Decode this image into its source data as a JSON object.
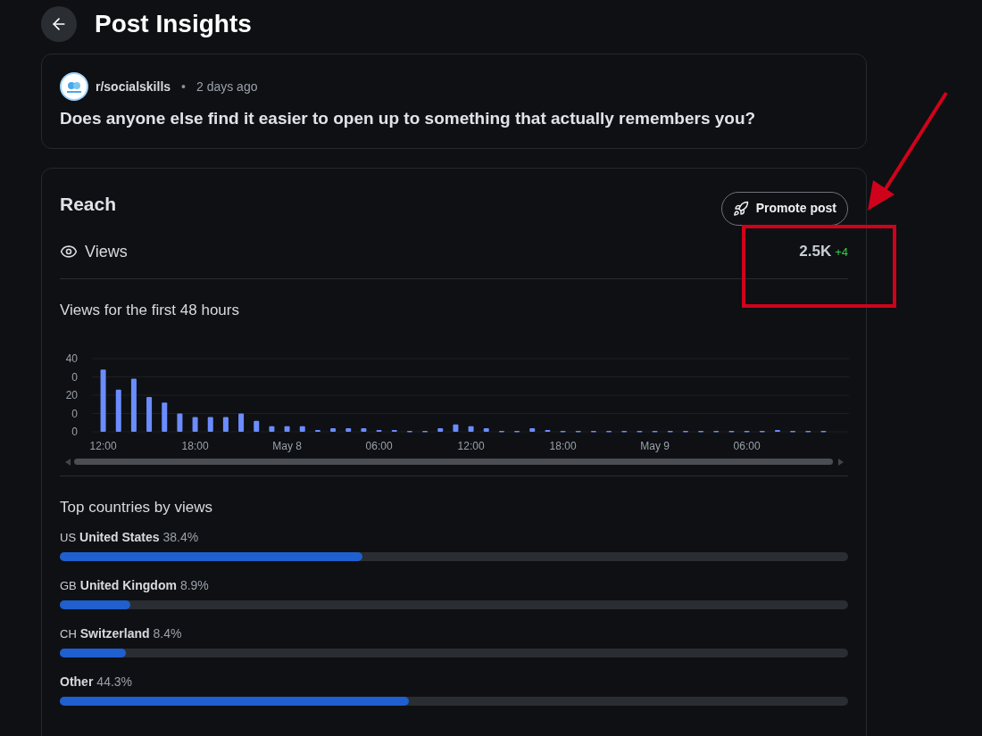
{
  "header": {
    "title": "Post Insights"
  },
  "post": {
    "community": "r/socialskills",
    "separator": "•",
    "time": "2 days ago",
    "title": "Does anyone else find it easier to open up to something that actually remembers you?"
  },
  "reach": {
    "title": "Reach",
    "promote_button": "Promote post",
    "metric": {
      "label": "Views",
      "value": "2.5K",
      "change": "+4"
    },
    "chart_title": "Views for the first 48 hours",
    "chart_data": {
      "type": "bar",
      "categories": [
        "12:00",
        null,
        null,
        null,
        null,
        null,
        "18:00",
        null,
        null,
        null,
        null,
        null,
        "May 8",
        null,
        null,
        null,
        null,
        null,
        "06:00",
        null,
        null,
        null,
        null,
        null,
        "12:00",
        null,
        null,
        null,
        null,
        null,
        "18:00",
        null,
        null,
        null,
        null,
        null,
        "May 9",
        null,
        null,
        null,
        null,
        null,
        "06:00",
        null,
        null,
        null,
        null,
        null
      ],
      "series": [
        {
          "color": "#6b8cff",
          "values": [
            34,
            23,
            29,
            19,
            16,
            10,
            8,
            8,
            8,
            10,
            6,
            3,
            3,
            3,
            1,
            2,
            2,
            2,
            1,
            1,
            0.5,
            0.5,
            2,
            4,
            3,
            2,
            0.5,
            0.5,
            2,
            1,
            0.5,
            0.5,
            0.5,
            0.5,
            0.5,
            0.5,
            0.5,
            0.5,
            0.5,
            0.5,
            0.5,
            0.5,
            0.5,
            0.5,
            1,
            0.5,
            0.5,
            0.5
          ]
        }
      ],
      "ylim": [
        0,
        40
      ],
      "yticks": [
        0,
        20,
        40
      ]
    },
    "chart_clipped_y_labels": [
      "0",
      "0"
    ],
    "countries_title": "Top countries by views",
    "countries": [
      {
        "code": "US",
        "name": "United States",
        "share": "38.4%",
        "level": 0.384
      },
      {
        "code": "GB",
        "name": "United Kingdom",
        "share": "8.9%",
        "level": 0.089
      },
      {
        "code": "CH",
        "name": "Switzerland",
        "share": "8.4%",
        "level": 0.084
      },
      {
        "name": "Other",
        "share": "44.3%",
        "level": 0.443
      }
    ]
  }
}
